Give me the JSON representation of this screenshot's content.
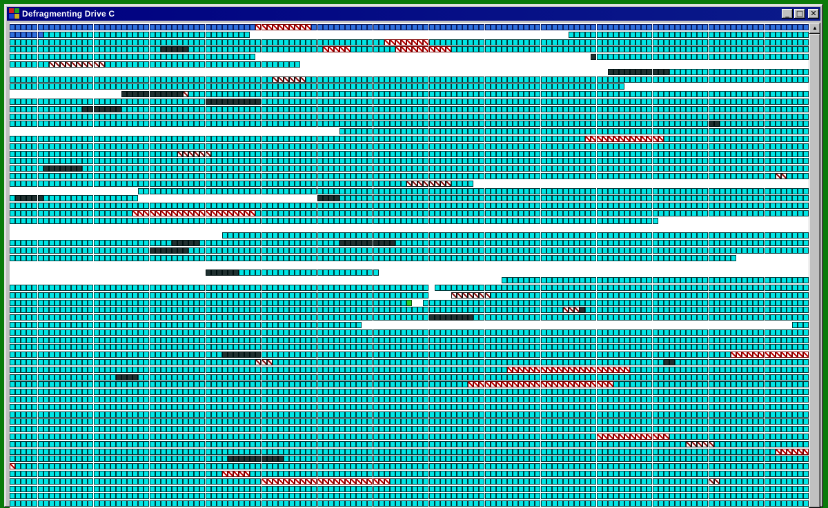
{
  "window": {
    "title": "Defragmenting Drive C",
    "minimize_glyph": "_",
    "maximize_glyph": "□",
    "close_glyph": "✕"
  },
  "colors": {
    "desktop": "#0a7a0a",
    "unmoved_cluster": "#00e6e6",
    "optimized_cluster": "#2f6fdc",
    "unmovable_cluster": "#203030",
    "bad_cluster": "#c00000",
    "reading_cluster": "#2bd22b",
    "free_space": "#ffffff"
  },
  "scrollbar": {
    "up_glyph": "▲"
  },
  "cluster_map": {
    "columns": 143,
    "rows_shown": 65,
    "legend_states": [
      "unmoved",
      "optimized",
      "unmovable",
      "bad",
      "reading",
      "free"
    ],
    "rows": [
      {
        "runs": [
          [
            "b",
            0,
            44
          ],
          [
            "r",
            44,
            10
          ],
          [
            "b",
            54,
            89
          ]
        ]
      },
      {
        "runs": [
          [
            "b",
            0,
            6
          ],
          [
            "c",
            6,
            37
          ],
          [
            "c",
            100,
            43
          ]
        ]
      },
      {
        "runs": [
          [
            "c",
            0,
            67
          ],
          [
            "r",
            67,
            8
          ],
          [
            "c",
            75,
            68
          ]
        ]
      },
      {
        "runs": [
          [
            "c",
            0,
            27
          ],
          [
            "d",
            27,
            5
          ],
          [
            "c",
            32,
            24
          ],
          [
            "r",
            56,
            5
          ],
          [
            "c",
            61,
            8
          ],
          [
            "r",
            69,
            10
          ],
          [
            "c",
            79,
            64
          ]
        ]
      },
      {
        "runs": [
          [
            "c",
            0,
            44
          ],
          [
            "d",
            104,
            1
          ],
          [
            "c",
            105,
            38
          ]
        ]
      },
      {
        "runs": [
          [
            "c",
            0,
            7
          ],
          [
            "k",
            7,
            10
          ],
          [
            "c",
            17,
            35
          ]
        ]
      },
      {
        "runs": [
          [
            "d",
            107,
            11
          ],
          [
            "c",
            118,
            25
          ]
        ]
      },
      {
        "runs": [
          [
            "c",
            0,
            47
          ],
          [
            "k",
            47,
            6
          ],
          [
            "c",
            53,
            90
          ]
        ]
      },
      {
        "runs": [
          [
            "c",
            0,
            110
          ]
        ]
      },
      {
        "runs": [
          [
            "d",
            20,
            11
          ],
          [
            "k",
            31,
            1
          ],
          [
            "c",
            32,
            111
          ]
        ]
      },
      {
        "runs": [
          [
            "c",
            0,
            35
          ],
          [
            "d",
            35,
            10
          ],
          [
            "c",
            45,
            98
          ]
        ]
      },
      {
        "runs": [
          [
            "c",
            0,
            13
          ],
          [
            "d",
            13,
            7
          ],
          [
            "c",
            20,
            123
          ]
        ]
      },
      {
        "runs": [
          [
            "c",
            0,
            143
          ]
        ]
      },
      {
        "runs": [
          [
            "c",
            0,
            125
          ],
          [
            "d",
            125,
            2
          ],
          [
            "c",
            127,
            16
          ]
        ]
      },
      {
        "runs": [
          [
            "c",
            59,
            84
          ]
        ]
      },
      {
        "runs": [
          [
            "c",
            0,
            103
          ],
          [
            "r",
            103,
            14
          ],
          [
            "c",
            117,
            26
          ]
        ]
      },
      {
        "runs": [
          [
            "c",
            0,
            143
          ]
        ]
      },
      {
        "runs": [
          [
            "c",
            0,
            30
          ],
          [
            "k",
            30,
            6
          ],
          [
            "c",
            36,
            107
          ]
        ]
      },
      {
        "runs": [
          [
            "c",
            0,
            143
          ]
        ]
      },
      {
        "runs": [
          [
            "c",
            0,
            6
          ],
          [
            "d",
            6,
            7
          ],
          [
            "c",
            13,
            130
          ]
        ]
      },
      {
        "runs": [
          [
            "c",
            0,
            137
          ],
          [
            "k",
            137,
            2
          ],
          [
            "c",
            139,
            4
          ]
        ]
      },
      {
        "runs": [
          [
            "c",
            0,
            71
          ],
          [
            "k",
            71,
            8
          ],
          [
            "c",
            79,
            4
          ]
        ]
      },
      {
        "runs": [
          [
            "c",
            23,
            120
          ]
        ]
      },
      {
        "runs": [
          [
            "c",
            0,
            1
          ],
          [
            "d",
            1,
            5
          ],
          [
            "c",
            6,
            17
          ],
          [
            "d",
            55,
            4
          ],
          [
            "c",
            59,
            84
          ]
        ]
      },
      {
        "runs": [
          [
            "c",
            0,
            143
          ]
        ]
      },
      {
        "runs": [
          [
            "c",
            0,
            22
          ],
          [
            "r",
            22,
            22
          ],
          [
            "c",
            44,
            99
          ]
        ]
      },
      {
        "runs": [
          [
            "c",
            0,
            116
          ]
        ]
      },
      {
        "runs": []
      },
      {
        "runs": [
          [
            "c",
            38,
            105
          ]
        ]
      },
      {
        "runs": [
          [
            "c",
            0,
            29
          ],
          [
            "d",
            29,
            5
          ],
          [
            "c",
            34,
            25
          ],
          [
            "d",
            59,
            10
          ],
          [
            "c",
            69,
            74
          ]
        ]
      },
      {
        "runs": [
          [
            "c",
            0,
            25
          ],
          [
            "d",
            25,
            7
          ],
          [
            "c",
            32,
            111
          ]
        ]
      },
      {
        "runs": [
          [
            "c",
            0,
            130
          ]
        ]
      },
      {
        "runs": []
      },
      {
        "runs": [
          [
            "d",
            35,
            6
          ],
          [
            "c",
            41,
            25
          ]
        ]
      },
      {
        "runs": [
          [
            "c",
            88,
            55
          ]
        ]
      },
      {
        "runs": [
          [
            "c",
            0,
            75
          ],
          [
            "c",
            76,
            67
          ]
        ]
      },
      {
        "runs": [
          [
            "c",
            0,
            75
          ],
          [
            "k",
            79,
            7
          ],
          [
            "c",
            86,
            57
          ]
        ]
      },
      {
        "runs": [
          [
            "c",
            0,
            71
          ],
          [
            "g",
            71,
            1
          ],
          [
            "c",
            74,
            69
          ]
        ]
      },
      {
        "runs": [
          [
            "c",
            0,
            99
          ],
          [
            "k",
            99,
            3
          ],
          [
            "d",
            102,
            1
          ],
          [
            "c",
            103,
            40
          ]
        ]
      },
      {
        "runs": [
          [
            "c",
            0,
            75
          ],
          [
            "d",
            75,
            8
          ],
          [
            "c",
            83,
            60
          ]
        ]
      },
      {
        "runs": [
          [
            "c",
            0,
            63
          ],
          [
            "c",
            140,
            3
          ]
        ]
      },
      {
        "runs": [
          [
            "c",
            0,
            143
          ]
        ]
      },
      {
        "runs": [
          [
            "c",
            0,
            143
          ]
        ]
      },
      {
        "runs": [
          [
            "c",
            0,
            143
          ]
        ]
      },
      {
        "runs": [
          [
            "c",
            0,
            38
          ],
          [
            "d",
            38,
            7
          ],
          [
            "c",
            45,
            84
          ],
          [
            "r",
            129,
            14
          ]
        ]
      },
      {
        "runs": [
          [
            "c",
            0,
            44
          ],
          [
            "k",
            44,
            3
          ],
          [
            "c",
            47,
            70
          ],
          [
            "d",
            117,
            2
          ],
          [
            "c",
            119,
            24
          ]
        ]
      },
      {
        "runs": [
          [
            "c",
            0,
            89
          ],
          [
            "r",
            89,
            22
          ],
          [
            "c",
            111,
            32
          ]
        ]
      },
      {
        "runs": [
          [
            "c",
            0,
            19
          ],
          [
            "d",
            19,
            4
          ],
          [
            "c",
            23,
            120
          ]
        ]
      },
      {
        "runs": [
          [
            "c",
            0,
            82
          ],
          [
            "r",
            82,
            26
          ],
          [
            "c",
            108,
            35
          ]
        ]
      },
      {
        "runs": [
          [
            "c",
            0,
            143
          ]
        ]
      },
      {
        "runs": [
          [
            "c",
            0,
            143
          ]
        ]
      },
      {
        "runs": [
          [
            "c",
            0,
            143
          ]
        ]
      },
      {
        "runs": [
          [
            "c",
            0,
            143
          ]
        ]
      },
      {
        "runs": [
          [
            "c",
            0,
            143
          ]
        ]
      },
      {
        "runs": [
          [
            "c",
            0,
            143
          ]
        ]
      },
      {
        "runs": [
          [
            "c",
            0,
            105
          ],
          [
            "r",
            105,
            13
          ],
          [
            "c",
            118,
            25
          ]
        ]
      },
      {
        "runs": [
          [
            "c",
            0,
            121
          ],
          [
            "k",
            121,
            5
          ],
          [
            "c",
            126,
            17
          ]
        ]
      },
      {
        "runs": [
          [
            "c",
            0,
            137
          ],
          [
            "r",
            137,
            6
          ]
        ]
      },
      {
        "runs": [
          [
            "c",
            0,
            39
          ],
          [
            "d",
            39,
            10
          ],
          [
            "c",
            49,
            94
          ]
        ]
      },
      {
        "runs": [
          [
            "r",
            0,
            1
          ],
          [
            "c",
            1,
            142
          ]
        ]
      },
      {
        "runs": [
          [
            "c",
            0,
            38
          ],
          [
            "r",
            38,
            5
          ],
          [
            "c",
            43,
            100
          ]
        ]
      },
      {
        "runs": [
          [
            "c",
            0,
            45
          ],
          [
            "r",
            45,
            23
          ],
          [
            "c",
            68,
            57
          ],
          [
            "k",
            125,
            2
          ],
          [
            "c",
            127,
            16
          ]
        ]
      },
      {
        "runs": [
          [
            "c",
            0,
            143
          ]
        ]
      },
      {
        "runs": [
          [
            "c",
            0,
            143
          ]
        ]
      },
      {
        "runs": [
          [
            "c",
            0,
            143
          ]
        ]
      }
    ]
  }
}
